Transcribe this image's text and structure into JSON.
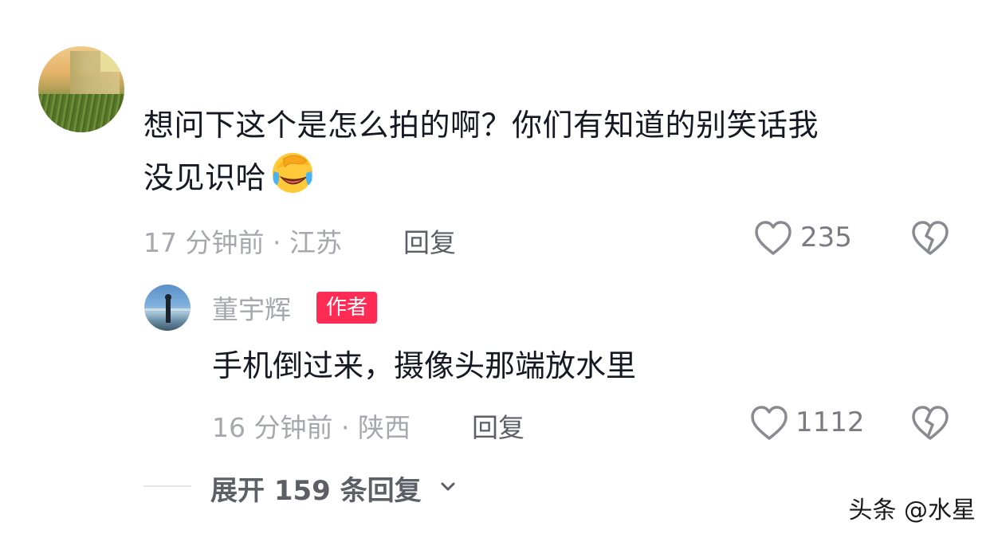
{
  "comment": {
    "text_line1": "想问下这个是怎么拍的啊？你们有知道的别笑话我",
    "text_line2": "没见识哈",
    "emoji": "facepalm-laughing-emoji",
    "time": "17 分钟前",
    "location": "江苏",
    "separator": "·",
    "reply_label": "回复",
    "like_count": "235"
  },
  "reply": {
    "author": "董宇辉",
    "badge": "作者",
    "text": "手机倒过来，摄像头那端放水里",
    "time": "16 分钟前",
    "location": "陕西",
    "separator": "·",
    "reply_label": "回复",
    "like_count": "1112"
  },
  "expand": {
    "label": "展开 159 条回复"
  },
  "watermark": "头条 @水星",
  "colors": {
    "badge": "#fe2c55",
    "text": "#161823",
    "meta": "#a6a8ad"
  }
}
